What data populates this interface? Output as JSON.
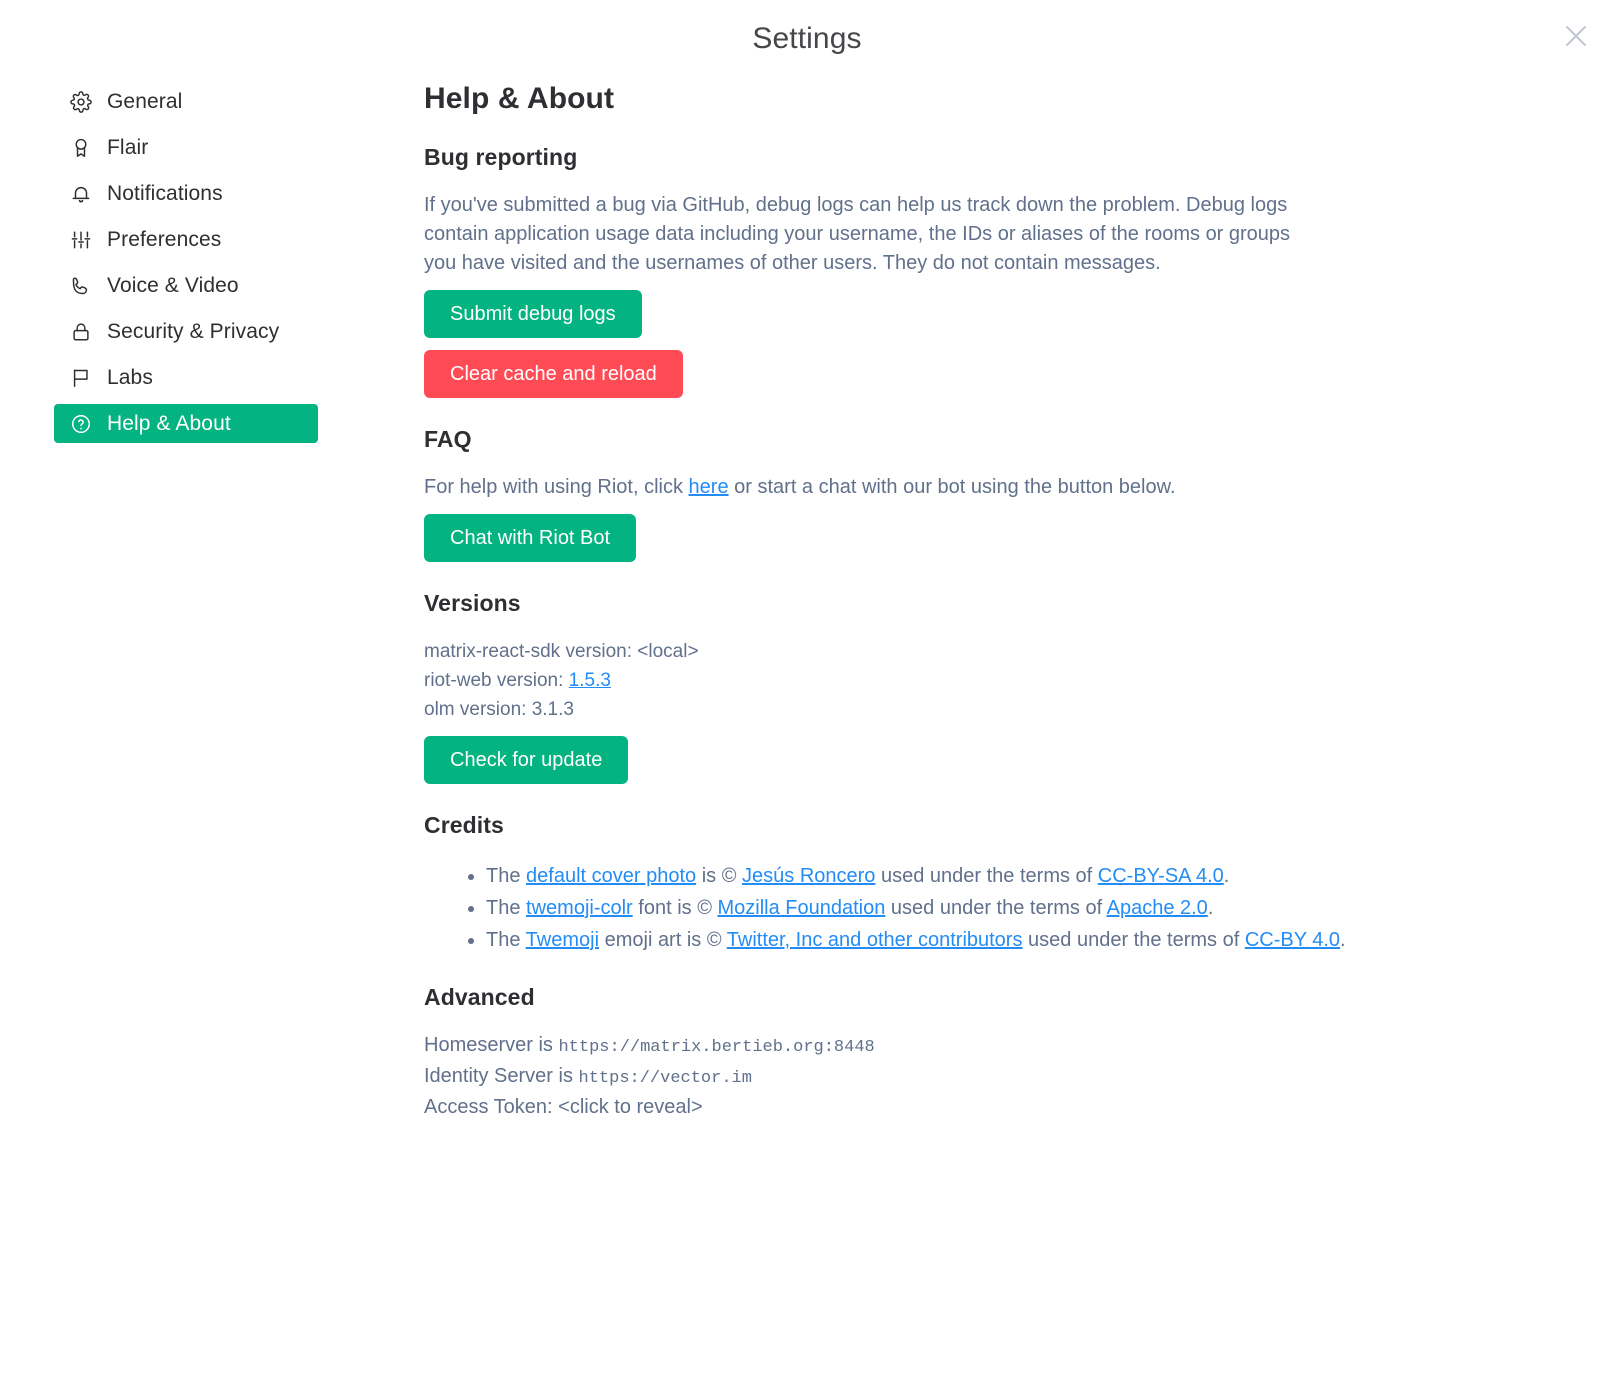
{
  "dialog": {
    "title": "Settings",
    "close_icon": "close-icon"
  },
  "sidebar": {
    "items": [
      {
        "label": "General",
        "icon": "gear-icon",
        "selected": false
      },
      {
        "label": "Flair",
        "icon": "rosette-icon",
        "selected": false
      },
      {
        "label": "Notifications",
        "icon": "bell-icon",
        "selected": false
      },
      {
        "label": "Preferences",
        "icon": "sliders-icon",
        "selected": false
      },
      {
        "label": "Voice & Video",
        "icon": "phone-icon",
        "selected": false
      },
      {
        "label": "Security & Privacy",
        "icon": "lock-icon",
        "selected": false
      },
      {
        "label": "Labs",
        "icon": "flag-icon",
        "selected": false
      },
      {
        "label": "Help & About",
        "icon": "question-circle-icon",
        "selected": true
      }
    ]
  },
  "main": {
    "page_title": "Help & About",
    "bug_reporting": {
      "heading": "Bug reporting",
      "paragraph": "If you've submitted a bug via GitHub, debug logs can help us track down the problem. Debug logs contain application usage data including your username, the IDs or aliases of the rooms or groups you have visited and the usernames of other users. They do not contain messages.",
      "submit_button": "Submit debug logs",
      "clear_cache_button": "Clear cache and reload"
    },
    "faq": {
      "heading": "FAQ",
      "text_before_link": "For help with using Riot, click ",
      "link_label": "here",
      "text_after_link": " or start a chat with our bot using the button below.",
      "chat_button": "Chat with Riot Bot"
    },
    "versions": {
      "heading": "Versions",
      "line_sdk": "matrix-react-sdk version: <local>",
      "line_riot_prefix": "riot-web version: ",
      "line_riot_link": "1.5.3",
      "line_olm": "olm version: 3.1.3",
      "check_update_button": "Check for update"
    },
    "credits": {
      "heading": "Credits",
      "items": [
        {
          "pre": "The ",
          "link1": "default cover photo",
          "mid1": " is © ",
          "link2": "Jesús Roncero",
          "mid2": " used under the terms of ",
          "link3": "CC-BY-SA 4.0",
          "post": "."
        },
        {
          "pre": "The ",
          "link1": "twemoji-colr",
          "mid1": " font is © ",
          "link2": "Mozilla Foundation",
          "mid2": " used under the terms of ",
          "link3": "Apache 2.0",
          "post": "."
        },
        {
          "pre": "The ",
          "link1": "Twemoji",
          "mid1": " emoji art is © ",
          "link2": "Twitter, Inc and other contributors",
          "mid2": " used under the terms of ",
          "link3": "CC-BY 4.0",
          "post": "."
        }
      ]
    },
    "advanced": {
      "heading": "Advanced",
      "homeserver_label": "Homeserver is ",
      "homeserver_value": "https://matrix.bertieb.org:8448",
      "identity_label": "Identity Server is ",
      "identity_value": "https://vector.im",
      "access_token_label": "Access Token: ",
      "access_token_value": "<click to reveal>"
    }
  },
  "colors": {
    "accent_green": "#03b381",
    "danger_red": "#ff4b55",
    "link_blue": "#238cf5",
    "body_text": "#61708b",
    "heading_text": "#2e2f32"
  }
}
